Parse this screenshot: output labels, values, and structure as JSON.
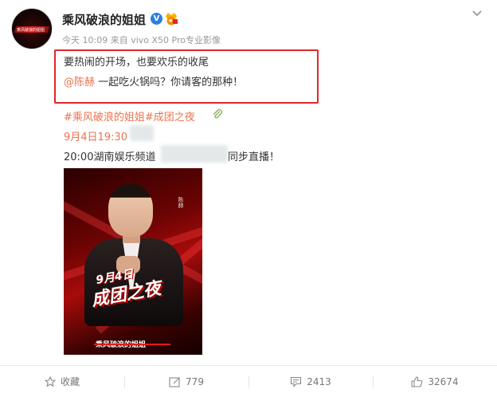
{
  "post": {
    "username": "乘风破浪的姐姐",
    "verified_mark": "V",
    "time": "今天 10:09",
    "source_prefix": "来自",
    "source_device": "vivo X50 Pro专业影像",
    "line1": "要热闹的开场，也要欢乐的收尾",
    "mention": "@陈赫",
    "line2_rest": " 一起吃火锅吗？你请客的那种！",
    "topic": "#乘风破浪的姐姐#成团之夜",
    "datetime": "9月4日19:30",
    "live_prefix": "20:00湖南娱乐频道",
    "live_suffix": "同步直播！",
    "avatar_text": "乘风破浪的姐姐"
  },
  "poster": {
    "date_art": "9月4日",
    "title_art": "成团之夜",
    "side_name": "陈赫",
    "show_name": "乘风破浪的姐姐"
  },
  "actions": {
    "favorite": "收藏",
    "repost_count": "779",
    "comment_count": "2413",
    "like_count": "32674"
  },
  "colors": {
    "link": "#eb7350",
    "highlight_box": "#e0262a",
    "verified": "#2b7fe0"
  },
  "icons": [
    "chevron-down-icon",
    "verified-icon",
    "vip-badge-icon",
    "paperclip-icon",
    "star-icon",
    "repost-icon",
    "comment-icon",
    "like-icon"
  ]
}
